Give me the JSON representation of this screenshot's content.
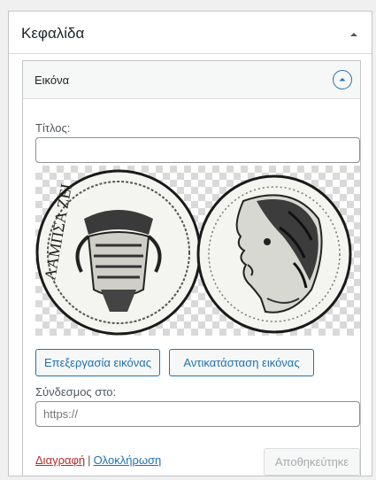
{
  "section": {
    "title": "Κεφαλίδα"
  },
  "widget": {
    "title": "Εικόνα",
    "fields": {
      "title_label": "Τίτλος:",
      "title_value": "",
      "link_label": "Σύνδεσμος στο:",
      "link_placeholder": "https://"
    },
    "image": {
      "description": "ancient silver coin obverse and reverse on transparent background",
      "coin_inscription": "ΛΑΜΠΣΑ ΖΕΙ"
    },
    "buttons": {
      "edit_image": "Επεξεργασία εικόνας",
      "replace_image": "Αντικατάσταση εικόνας",
      "saved": "Αποθηκεύτηκε"
    },
    "links": {
      "delete": "Διαγραφή",
      "separator": "|",
      "done": "Ολοκλήρωση"
    }
  },
  "colors": {
    "accent": "#2271b1",
    "delete": "#b32d2e",
    "border": "#c3c4c7",
    "background": "#f0f0f1"
  },
  "icons": {
    "panel_toggle": "caret-up-icon",
    "widget_toggle": "circle-caret-up-icon"
  }
}
